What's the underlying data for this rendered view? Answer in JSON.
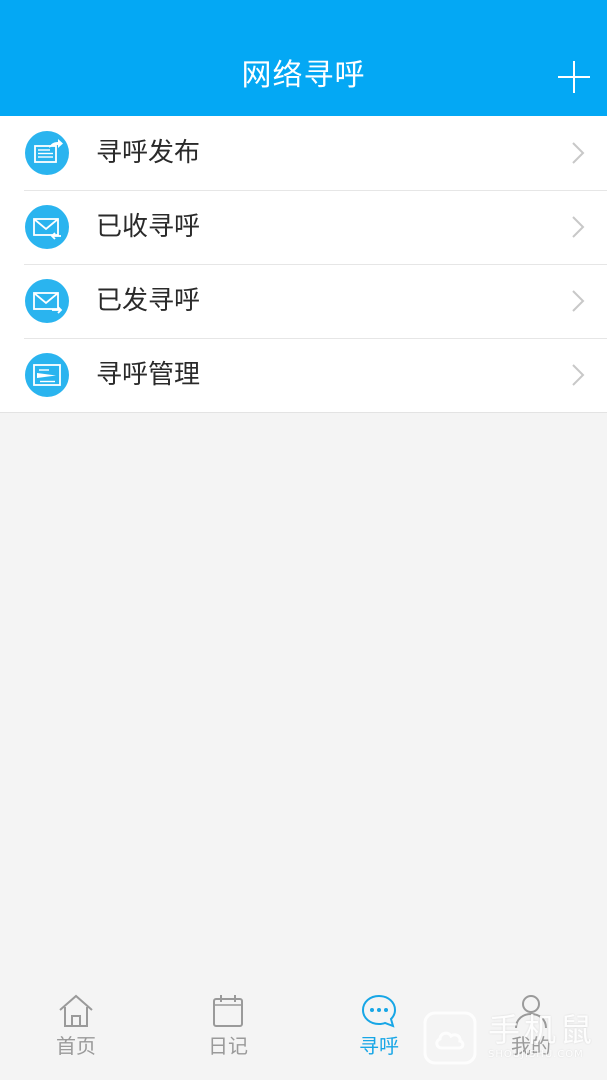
{
  "header": {
    "title": "网络寻呼",
    "add_icon": "plus-icon",
    "background_color": "#04a8f4"
  },
  "menu": {
    "items": [
      {
        "label": "寻呼发布",
        "icon": "publish-page-icon"
      },
      {
        "label": "已收寻呼",
        "icon": "received-mail-icon"
      },
      {
        "label": "已发寻呼",
        "icon": "sent-mail-icon"
      },
      {
        "label": "寻呼管理",
        "icon": "manage-page-icon"
      }
    ],
    "icon_color": "#2ab4ef"
  },
  "tabbar": {
    "tabs": [
      {
        "label": "首页",
        "icon": "home-icon",
        "active": false
      },
      {
        "label": "日记",
        "icon": "calendar-icon",
        "active": false
      },
      {
        "label": "寻呼",
        "icon": "chat-bubble-icon",
        "active": true
      },
      {
        "label": "我的",
        "icon": "user-icon",
        "active": false
      }
    ],
    "active_color": "#17a6e6",
    "inactive_color": "#9a9a9a"
  },
  "watermark": {
    "text": "手机鼠",
    "subtext": "SHOUJISHU.COM"
  }
}
